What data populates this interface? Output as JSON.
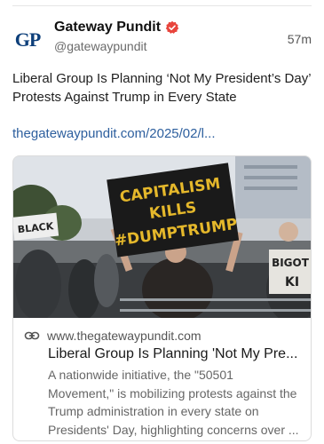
{
  "post": {
    "author_name": "Gateway Pundit",
    "avatar_text": "GP",
    "handle": "@gatewaypundit",
    "time": "57m",
    "text": "Liberal Group Is Planning ‘Not My President’s Day’ Protests Against Trump in Every State",
    "link_text": "thegatewaypundit.com/2025/02/l..."
  },
  "card": {
    "domain": "www.thegatewaypundit.com",
    "title": "Liberal Group Is Planning 'Not My Pre...",
    "description": "A nationwide initiative, the \"50501 Movement,\" is mobilizing protests against the Trump administration in every state on Presidents' Day, highlighting concerns over ...",
    "image_sign": {
      "line1": "CAPITALISM",
      "line2": "KILLS",
      "line3": "#DUMPTRUMP"
    },
    "image_left_sign": "BLACK",
    "image_right_sign": "BIGOT\nKI"
  },
  "colors": {
    "brand": "#0d3f7a",
    "link": "#2d5f9e",
    "verified": "#e8453c"
  },
  "icons": {
    "verified": "verified-badge-icon",
    "link": "link-icon"
  }
}
